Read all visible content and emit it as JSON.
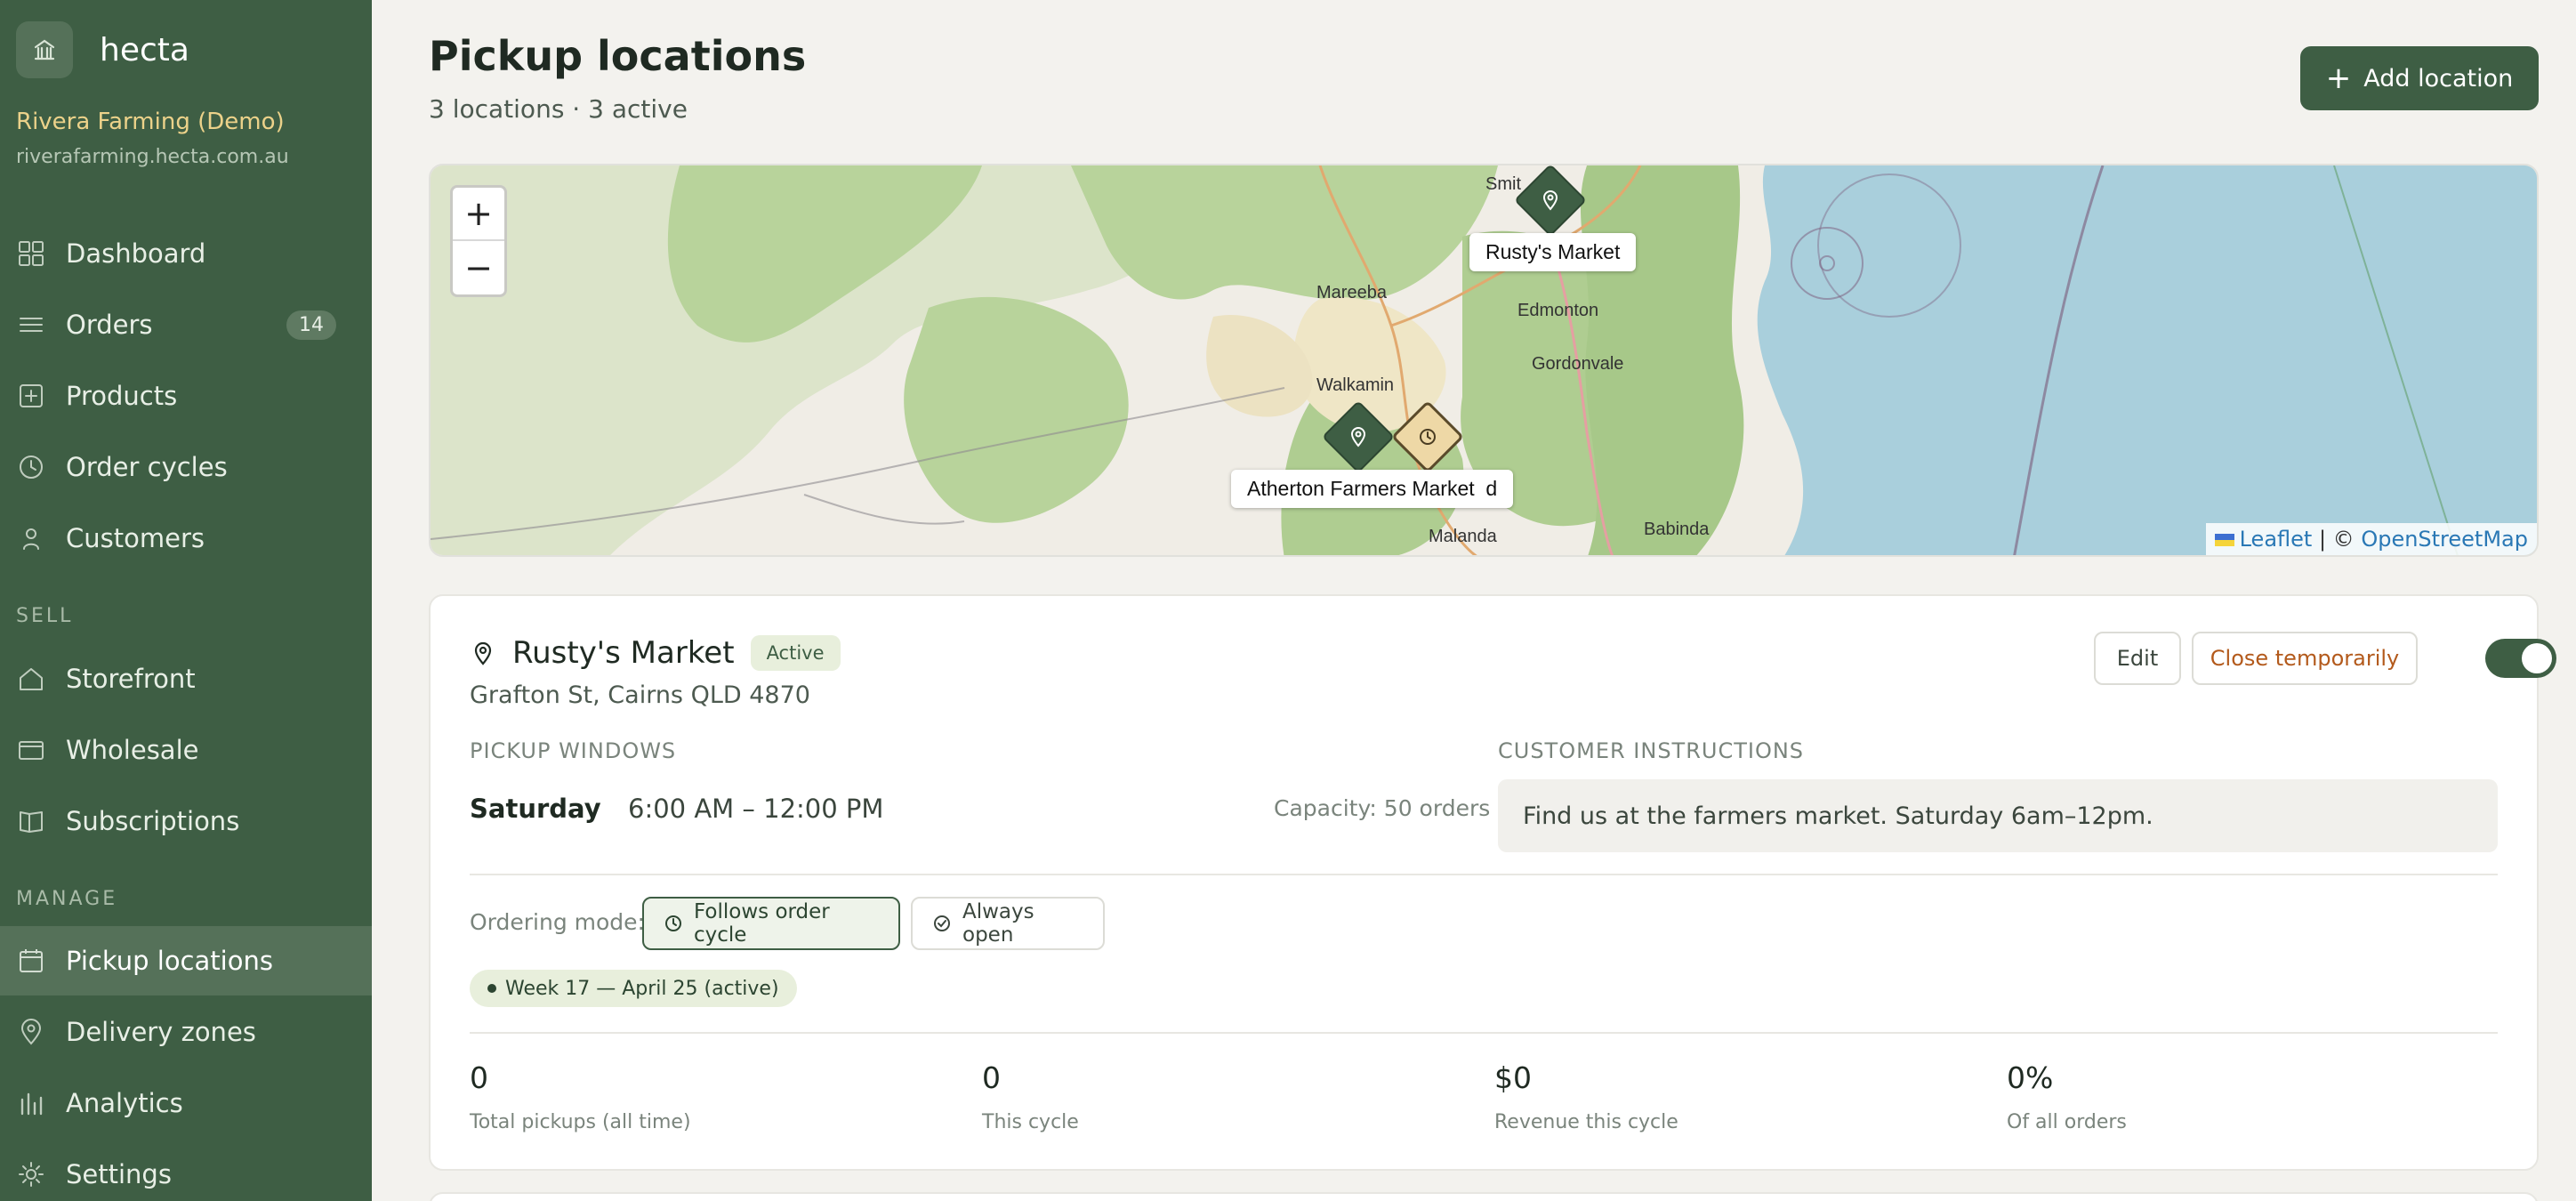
{
  "app": {
    "name": "hecta"
  },
  "org": {
    "name": "Rivera Farming (Demo)",
    "domain": "riverafarming.hecta.com.au"
  },
  "nav": {
    "dashboard": "Dashboard",
    "orders": "Orders",
    "orders_badge": "14",
    "products": "Products",
    "order_cycles": "Order cycles",
    "customers": "Customers",
    "sell_label": "SELL",
    "storefront": "Storefront",
    "wholesale": "Wholesale",
    "subscriptions": "Subscriptions",
    "manage_label": "MANAGE",
    "pickup_locations": "Pickup locations",
    "delivery_zones": "Delivery zones",
    "analytics": "Analytics",
    "settings": "Settings"
  },
  "header": {
    "title": "Pickup locations",
    "subtitle": "3 locations · 3 active",
    "add_button": "Add location"
  },
  "map": {
    "zoom_in": "+",
    "zoom_out": "−",
    "attribution_leaflet": "Leaflet",
    "attribution_sep": " | © ",
    "attribution_osm": "OpenStreetMap",
    "places": {
      "smithfield": "Smit",
      "mareeba": "Mareeba",
      "edmonton": "Edmonton",
      "gordonvale": "Gordonvale",
      "walkamin": "Walkamin",
      "malanda": "Malanda",
      "babinda": "Babinda"
    },
    "marker_labels": {
      "rustys": "Rusty's Market",
      "atherton": "Atherton Farmers Market",
      "overlap_fragment": "d"
    }
  },
  "location_card": {
    "name": "Rusty's Market",
    "status": "Active",
    "address": "Grafton St, Cairns QLD 4870",
    "edit_button": "Edit",
    "close_button": "Close temporarily",
    "pickup_windows_label": "PICKUP WINDOWS",
    "window_day": "Saturday",
    "window_time": "6:00 AM – 12:00 PM",
    "capacity": "Capacity: 50 orders",
    "instructions_label": "CUSTOMER INSTRUCTIONS",
    "instructions": "Find us at the farmers market. Saturday 6am–12pm.",
    "ordering_mode_label": "Ordering mode:",
    "mode_follows": "Follows order cycle",
    "mode_always": "Always open",
    "cycle_pill": "Week 17 — April 25 (active)",
    "stats": [
      {
        "value": "0",
        "label": "Total pickups (all time)"
      },
      {
        "value": "0",
        "label": "This cycle"
      },
      {
        "value": "$0",
        "label": "Revenue this cycle"
      },
      {
        "value": "0%",
        "label": "Of all orders"
      }
    ]
  },
  "colors": {
    "sidebar": "#3e5e44",
    "accent": "#3e5e44",
    "warning_text": "#b35a1c",
    "org_name": "#ecd28a"
  }
}
